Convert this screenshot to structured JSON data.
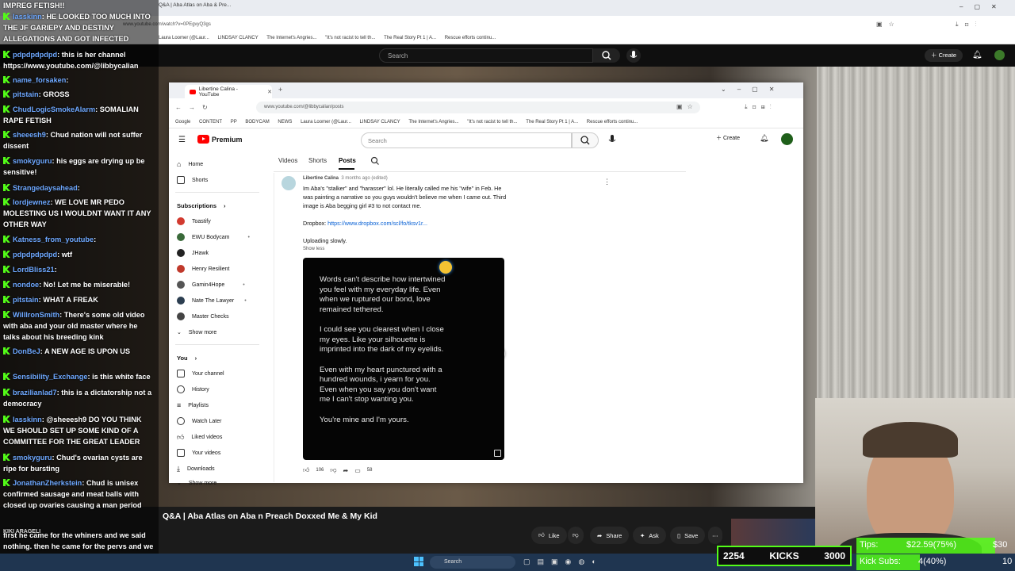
{
  "outer": {
    "tab_title": "Q&A | Aba Atlas on Aba & Pre...",
    "url": "www.youtube.com/watch?v=0PEgvyQ3gs",
    "bookmarks": [
      "Laura Loomer (@Laur...",
      "LINDSAY CLANCY",
      "The Internet's Angries...",
      "\"It's not racist to tell th...",
      "The Real Story Pt 1 | A...",
      "Rescue efforts continu..."
    ],
    "search_placeholder": "Search",
    "create_label": "Create"
  },
  "inner": {
    "tab_title": "Libertine Calina - YouTube",
    "url": "www.youtube.com/@libbycalian/posts",
    "bookmarks": [
      "Google",
      "CONTENT",
      "PP",
      "BODYCAM",
      "NEWS",
      "Laura Loomer (@Laur...",
      "LINDSAY CLANCY",
      "The Internet's Angries...",
      "\"It's not racist to tell th...",
      "The Real Story Pt 1 | A...",
      "Rescue efforts continu..."
    ],
    "logo_text": "Premium",
    "search_placeholder": "Search",
    "create_label": "Create",
    "tabs": [
      "Videos",
      "Shorts",
      "Posts"
    ],
    "sidebar": {
      "top": [
        {
          "label": "Home",
          "icon": "home-icon"
        },
        {
          "label": "Shorts",
          "icon": "shorts-icon"
        }
      ],
      "subs_header": "Subscriptions",
      "subs": [
        {
          "label": "Toastify",
          "color": "#d23a2f"
        },
        {
          "label": "EWU Bodycam",
          "color": "#3a6a3a"
        },
        {
          "label": "JHawk",
          "color": "#222222"
        },
        {
          "label": "Henry Resilient",
          "color": "#c0392b"
        },
        {
          "label": "Gamin4Hope",
          "color": "#555555"
        },
        {
          "label": "Nate The Lawyer",
          "color": "#2c3e50"
        },
        {
          "label": "Master Checks",
          "color": "#444444"
        }
      ],
      "show_more": "Show more",
      "you_header": "You",
      "you": [
        {
          "label": "Your channel",
          "icon": "channel-icon"
        },
        {
          "label": "History",
          "icon": "history-icon"
        },
        {
          "label": "Playlists",
          "icon": "playlists-icon"
        },
        {
          "label": "Watch Later",
          "icon": "watch-later-icon"
        },
        {
          "label": "Liked videos",
          "icon": "like-icon"
        },
        {
          "label": "Your videos",
          "icon": "your-videos-icon"
        },
        {
          "label": "Downloads",
          "icon": "download-icon"
        }
      ],
      "show_more2": "Show more"
    },
    "post": {
      "author": "Libertine Calina",
      "time": "3 months ago (edited)",
      "text": "Im Aba's \"stalker\" and \"harasser\" lol. He literally called me his \"wife\" in Feb. He was painting a narrative so you guys wouldn't believe me when I came out. Third image is Aba begging girl #3 to not contact me.",
      "dropbox_label": "Dropbox:",
      "dropbox_link": "https://www.dropbox.com/scl/fo/tksv1r...",
      "uploading": "Uploading slowly.",
      "show_less": "Show less",
      "image_lines": [
        "Words can't describe how intertwined you feel with my everyday life. Even when we ruptured our bond, love remained tethered.",
        "I could see you clearest when I close my eyes. Like your silhouette is imprinted into the dark of my eyelids.",
        "Even with my heart punctured with a hundred wounds, i yearn for you. Even when you say you don't want me I can't stop wanting you.",
        "You're mine and I'm yours."
      ],
      "likes": "106",
      "comments": "58"
    }
  },
  "chat": [
    {
      "user": "",
      "text": "IMPREG FETISH!!"
    },
    {
      "user": "lasskinn",
      "text": "HE LOOKED TOO MUCH INTO THE JF GARIEPY AND DESTINY ALLEGATIONS AND GOT INFECTED"
    },
    {
      "user": "pdpdpdpdpd",
      "text": "this is her channel https://www.youtube.com/@libbycalian"
    },
    {
      "user": "name_forsaken",
      "text": ""
    },
    {
      "user": "pitstain",
      "text": "GROSS"
    },
    {
      "user": "ChudLogicSmokeAlarm",
      "text": "SOMALIAN RAPE FETISH"
    },
    {
      "user": "sheeesh9",
      "text": "Chud nation will not suffer dissent"
    },
    {
      "user": "smokyguru",
      "text": "his eggs are drying up be sensitive!"
    },
    {
      "user": "Strangedaysahead",
      "text": ""
    },
    {
      "user": "lordjewnez",
      "text": "WE LOVE MR PEDO MOLESTING US I WOULDNT WANT IT ANY OTHER WAY"
    },
    {
      "user": "Katness_from_youtube",
      "text": ""
    },
    {
      "user": "pdpdpdpdpd",
      "text": "wtf"
    },
    {
      "user": "LordBliss21",
      "text": ""
    },
    {
      "user": "nondoe",
      "text": "No! Let me be miserable!"
    },
    {
      "user": "pitstain",
      "text": "WHAT A FREAK"
    },
    {
      "user": "WillIronSmith",
      "text": "There's some old video with aba and your old master where he talks about his breeding kink"
    },
    {
      "user": "DonBeJ",
      "text": "A NEW AGE IS UPON US"
    },
    {
      "user": "Sensibility_Exchange",
      "text": "is this white face"
    },
    {
      "user": "brazilianlad7",
      "text": "this is a dictatorship not a democracy"
    },
    {
      "user": "lasskinn",
      "text": "@sheeesh9 DO YOU THINK WE SHOULD SET UP SOME KIND OF A COMMITTEE FOR THE GREAT LEADER"
    },
    {
      "user": "smokyguru",
      "text": "Chud's ovarian cysts are ripe for bursting"
    },
    {
      "user": "JonathanZherkstein",
      "text": "Chud is unisex confirmed sausage and meat balls with closed up ovaries causing a man period"
    },
    {
      "user": "",
      "text": "first he came for the whiners and we said nothing. then he came for the pervs and we said nothing"
    }
  ],
  "video": {
    "title": "Q&A | Aba Atlas on Aba n Preach Doxxed Me & My Kid",
    "actions": [
      "Like",
      "Share",
      "Ask",
      "Save"
    ],
    "user_badge": "KIKI ARAGELI"
  },
  "taskbar": {
    "search": "Search"
  },
  "kicks": {
    "count": "2254",
    "label": "KICKS",
    "goal": "3000"
  },
  "tips": {
    "label": "Tips:",
    "value": "$22.59(75%)",
    "goal": "$30",
    "subs_label": "Kick Subs:",
    "subs_value": "4(40%)",
    "subs_goal": "10"
  }
}
